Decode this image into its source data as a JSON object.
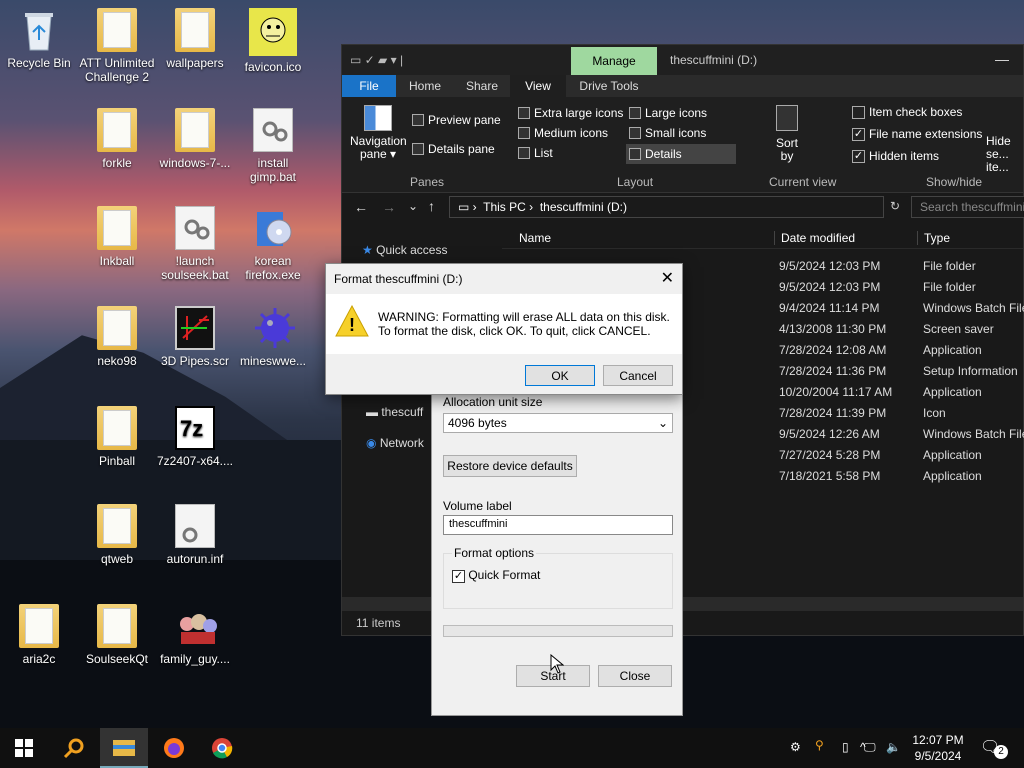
{
  "desktop": {
    "icons": [
      {
        "label": "Recycle Bin"
      },
      {
        "label": "ATT Unlimited Challenge 2"
      },
      {
        "label": "wallpapers"
      },
      {
        "label": "favicon.ico"
      },
      {
        "label": "forkle"
      },
      {
        "label": "windows-7-..."
      },
      {
        "label": "install gimp.bat"
      },
      {
        "label": "Inkball"
      },
      {
        "label": "!launch soulseek.bat"
      },
      {
        "label": "korean firefox.exe"
      },
      {
        "label": "neko98"
      },
      {
        "label": "3D Pipes.scr"
      },
      {
        "label": "mineswwe..."
      },
      {
        "label": "Pinball"
      },
      {
        "label": "7z2407-x64...."
      },
      {
        "label": "qtweb"
      },
      {
        "label": "autorun.inf"
      },
      {
        "label": "aria2c"
      },
      {
        "label": "SoulseekQt"
      },
      {
        "label": "family_guy...."
      }
    ]
  },
  "explorer": {
    "title": "thescuffmini (D:)",
    "manage_tab": "Manage",
    "tabs": [
      "File",
      "Home",
      "Share",
      "View",
      "Drive Tools"
    ],
    "ribbon": {
      "nav_pane": "Navigation pane",
      "preview_pane": "Preview pane",
      "details_pane": "Details pane",
      "panes_group": "Panes",
      "layout_items": [
        "Extra large icons",
        "Large icons",
        "Medium icons",
        "Small icons",
        "List",
        "Details"
      ],
      "layout_group": "Layout",
      "sort_by": "Sort by",
      "current_view_group": "Current view",
      "item_check_boxes": "Item check boxes",
      "file_name_extensions": "File name extensions",
      "hidden_items": "Hidden items",
      "hide_selected": "Hide se... ite...",
      "show_hide_group": "Show/hide"
    },
    "address": {
      "crumbs": [
        "This PC",
        "thescuffmini (D:)"
      ],
      "search_placeholder": "Search thescuffmini (D:)"
    },
    "nav": {
      "quick_access": "Quick access",
      "drive": "thescuff",
      "network": "Network"
    },
    "columns": {
      "name": "Name",
      "date": "Date modified",
      "type": "Type"
    },
    "rows": [
      {
        "date": "9/5/2024 12:03 PM",
        "type": "File folder"
      },
      {
        "date": "9/5/2024 12:03 PM",
        "type": "File folder"
      },
      {
        "date": "9/4/2024 11:14 PM",
        "type": "Windows Batch File"
      },
      {
        "date": "4/13/2008 11:30 PM",
        "type": "Screen saver"
      },
      {
        "date": "7/28/2024 12:08 AM",
        "type": "Application"
      },
      {
        "date": "7/28/2024 11:36 PM",
        "type": "Setup Information"
      },
      {
        "date": "10/20/2004 11:17 AM",
        "type": "Application"
      },
      {
        "date": "7/28/2024 11:39 PM",
        "type": "Icon"
      },
      {
        "date": "9/5/2024 12:26 AM",
        "type": "Windows Batch File"
      },
      {
        "date": "7/27/2024 5:28 PM",
        "type": "Application"
      },
      {
        "date": "7/18/2021 5:58 PM",
        "type": "Application"
      }
    ],
    "status": "11 items"
  },
  "format_dialog": {
    "allocation_label": "Allocation unit size",
    "allocation_value": "4096 bytes",
    "restore_defaults": "Restore device defaults",
    "volume_label_caption": "Volume label",
    "volume_label_value": "thescuffmini",
    "format_options": "Format options",
    "quick_format": "Quick Format",
    "start": "Start",
    "close": "Close"
  },
  "warning_dialog": {
    "title": "Format thescuffmini (D:)",
    "message_line1": "WARNING: Formatting will erase ALL data on this disk.",
    "message_line2": "To format the disk, click OK. To quit, click CANCEL.",
    "ok": "OK",
    "cancel": "Cancel"
  },
  "taskbar": {
    "time": "12:07 PM",
    "date": "9/5/2024",
    "notifications": "2"
  },
  "colors": {
    "accent": "#1a73c8",
    "manage_tab": "#9fd89f"
  }
}
